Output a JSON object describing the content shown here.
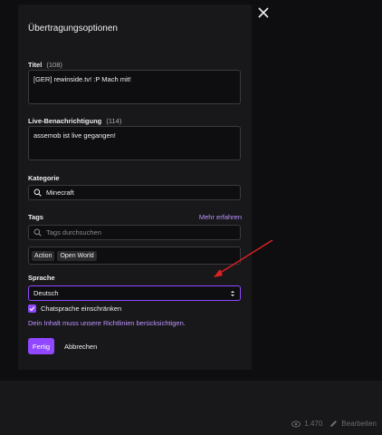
{
  "modal": {
    "title": "Übertragungsoptionen",
    "title_field": {
      "label": "Titel",
      "count": "(108)",
      "value": "[GER] rewinside.tv! :P Mach mit!"
    },
    "notification_field": {
      "label": "Live-Benachrichtigung",
      "count": "(114)",
      "value": "assemob ist live gegangen!"
    },
    "category_field": {
      "label": "Kategorie",
      "value": "Minecraft"
    },
    "tags_field": {
      "label": "Tags",
      "learn_more": "Mehr erfahren",
      "search_placeholder": "Tags durchsuchen",
      "tags": [
        "Action",
        "Open World"
      ]
    },
    "language_field": {
      "label": "Sprache",
      "value": "Deutsch"
    },
    "restrict_chat": {
      "label": "Chatsprache einschränken",
      "checked": true
    },
    "guidelines_note": "Dein Inhalt muss unsere Richtlinien berücksichtigen.",
    "done_button": "Fertig",
    "cancel_button": "Abbrechen"
  },
  "background": {
    "viewer_count": "1.470",
    "edit_label": "Bearbeiten"
  },
  "colors": {
    "accent": "#9147ff",
    "link": "#bf94ff",
    "annotation_arrow": "#e02020"
  },
  "icons": {
    "close": "close-icon",
    "search": "search-icon",
    "select_arrows": "select-arrows-icon",
    "checkmark": "checkmark-icon",
    "eye": "eye-icon",
    "pencil": "pencil-icon"
  }
}
